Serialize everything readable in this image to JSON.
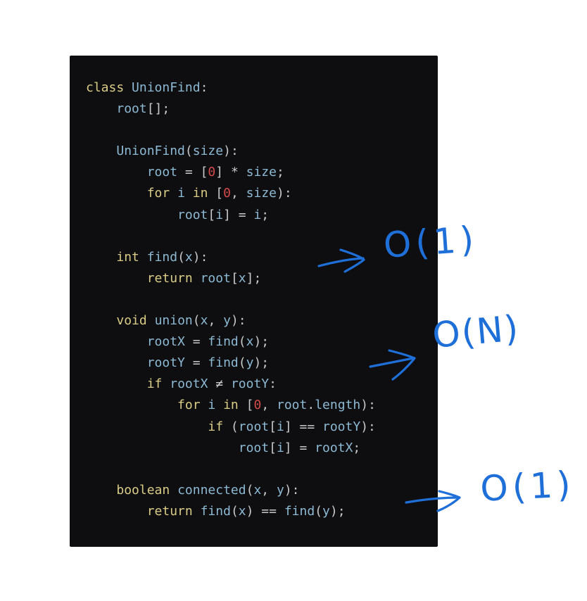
{
  "code": {
    "lines": [
      [
        {
          "t": "class",
          "k": "kw"
        },
        {
          "t": " ",
          "k": "pn"
        },
        {
          "t": "UnionFind",
          "k": "fn"
        },
        {
          "t": ":",
          "k": "pn"
        }
      ],
      [
        {
          "t": "    ",
          "k": "pn"
        },
        {
          "t": "root",
          "k": "var"
        },
        {
          "t": "[];",
          "k": "pn"
        }
      ],
      [],
      [
        {
          "t": "    ",
          "k": "pn"
        },
        {
          "t": "UnionFind",
          "k": "fn"
        },
        {
          "t": "(",
          "k": "pn"
        },
        {
          "t": "size",
          "k": "var"
        },
        {
          "t": "):",
          "k": "pn"
        }
      ],
      [
        {
          "t": "        ",
          "k": "pn"
        },
        {
          "t": "root",
          "k": "var"
        },
        {
          "t": " = [",
          "k": "pn"
        },
        {
          "t": "0",
          "k": "num"
        },
        {
          "t": "] * ",
          "k": "pn"
        },
        {
          "t": "size",
          "k": "var"
        },
        {
          "t": ";",
          "k": "pn"
        }
      ],
      [
        {
          "t": "        ",
          "k": "pn"
        },
        {
          "t": "for",
          "k": "kw"
        },
        {
          "t": " ",
          "k": "pn"
        },
        {
          "t": "i",
          "k": "var"
        },
        {
          "t": " ",
          "k": "pn"
        },
        {
          "t": "in",
          "k": "kw"
        },
        {
          "t": " [",
          "k": "pn"
        },
        {
          "t": "0",
          "k": "num"
        },
        {
          "t": ", ",
          "k": "pn"
        },
        {
          "t": "size",
          "k": "var"
        },
        {
          "t": "):",
          "k": "pn"
        }
      ],
      [
        {
          "t": "            ",
          "k": "pn"
        },
        {
          "t": "root",
          "k": "var"
        },
        {
          "t": "[",
          "k": "pn"
        },
        {
          "t": "i",
          "k": "var"
        },
        {
          "t": "] = ",
          "k": "pn"
        },
        {
          "t": "i",
          "k": "var"
        },
        {
          "t": ";",
          "k": "pn"
        }
      ],
      [],
      [
        {
          "t": "    ",
          "k": "pn"
        },
        {
          "t": "int",
          "k": "kw"
        },
        {
          "t": " ",
          "k": "pn"
        },
        {
          "t": "find",
          "k": "fn"
        },
        {
          "t": "(",
          "k": "pn"
        },
        {
          "t": "x",
          "k": "var"
        },
        {
          "t": "):",
          "k": "pn"
        }
      ],
      [
        {
          "t": "        ",
          "k": "pn"
        },
        {
          "t": "return",
          "k": "kw"
        },
        {
          "t": " ",
          "k": "pn"
        },
        {
          "t": "root",
          "k": "var"
        },
        {
          "t": "[",
          "k": "pn"
        },
        {
          "t": "x",
          "k": "var"
        },
        {
          "t": "];",
          "k": "pn"
        }
      ],
      [],
      [
        {
          "t": "    ",
          "k": "pn"
        },
        {
          "t": "void",
          "k": "kw"
        },
        {
          "t": " ",
          "k": "pn"
        },
        {
          "t": "union",
          "k": "fn"
        },
        {
          "t": "(",
          "k": "pn"
        },
        {
          "t": "x",
          "k": "var"
        },
        {
          "t": ", ",
          "k": "pn"
        },
        {
          "t": "y",
          "k": "var"
        },
        {
          "t": "):",
          "k": "pn"
        }
      ],
      [
        {
          "t": "        ",
          "k": "pn"
        },
        {
          "t": "rootX",
          "k": "var"
        },
        {
          "t": " = ",
          "k": "pn"
        },
        {
          "t": "find",
          "k": "fn"
        },
        {
          "t": "(",
          "k": "pn"
        },
        {
          "t": "x",
          "k": "var"
        },
        {
          "t": ");",
          "k": "pn"
        }
      ],
      [
        {
          "t": "        ",
          "k": "pn"
        },
        {
          "t": "rootY",
          "k": "var"
        },
        {
          "t": " = ",
          "k": "pn"
        },
        {
          "t": "find",
          "k": "fn"
        },
        {
          "t": "(",
          "k": "pn"
        },
        {
          "t": "y",
          "k": "var"
        },
        {
          "t": ");",
          "k": "pn"
        }
      ],
      [
        {
          "t": "        ",
          "k": "pn"
        },
        {
          "t": "if",
          "k": "kw"
        },
        {
          "t": " ",
          "k": "pn"
        },
        {
          "t": "rootX",
          "k": "var"
        },
        {
          "t": " ≠ ",
          "k": "pn"
        },
        {
          "t": "rootY",
          "k": "var"
        },
        {
          "t": ":",
          "k": "pn"
        }
      ],
      [
        {
          "t": "            ",
          "k": "pn"
        },
        {
          "t": "for",
          "k": "kw"
        },
        {
          "t": " ",
          "k": "pn"
        },
        {
          "t": "i",
          "k": "var"
        },
        {
          "t": " ",
          "k": "pn"
        },
        {
          "t": "in",
          "k": "kw"
        },
        {
          "t": " [",
          "k": "pn"
        },
        {
          "t": "0",
          "k": "num"
        },
        {
          "t": ", ",
          "k": "pn"
        },
        {
          "t": "root",
          "k": "var"
        },
        {
          "t": ".",
          "k": "pn"
        },
        {
          "t": "length",
          "k": "var"
        },
        {
          "t": "):",
          "k": "pn"
        }
      ],
      [
        {
          "t": "                ",
          "k": "pn"
        },
        {
          "t": "if",
          "k": "kw"
        },
        {
          "t": " (",
          "k": "pn"
        },
        {
          "t": "root",
          "k": "var"
        },
        {
          "t": "[",
          "k": "pn"
        },
        {
          "t": "i",
          "k": "var"
        },
        {
          "t": "] == ",
          "k": "pn"
        },
        {
          "t": "rootY",
          "k": "var"
        },
        {
          "t": "):",
          "k": "pn"
        }
      ],
      [
        {
          "t": "                    ",
          "k": "pn"
        },
        {
          "t": "root",
          "k": "var"
        },
        {
          "t": "[",
          "k": "pn"
        },
        {
          "t": "i",
          "k": "var"
        },
        {
          "t": "] = ",
          "k": "pn"
        },
        {
          "t": "rootX",
          "k": "var"
        },
        {
          "t": ";",
          "k": "pn"
        }
      ],
      [],
      [
        {
          "t": "    ",
          "k": "pn"
        },
        {
          "t": "boolean",
          "k": "kw"
        },
        {
          "t": " ",
          "k": "pn"
        },
        {
          "t": "connected",
          "k": "fn"
        },
        {
          "t": "(",
          "k": "pn"
        },
        {
          "t": "x",
          "k": "var"
        },
        {
          "t": ", ",
          "k": "pn"
        },
        {
          "t": "y",
          "k": "var"
        },
        {
          "t": "):",
          "k": "pn"
        }
      ],
      [
        {
          "t": "        ",
          "k": "pn"
        },
        {
          "t": "return",
          "k": "kw"
        },
        {
          "t": " ",
          "k": "pn"
        },
        {
          "t": "find",
          "k": "fn"
        },
        {
          "t": "(",
          "k": "pn"
        },
        {
          "t": "x",
          "k": "var"
        },
        {
          "t": ") == ",
          "k": "pn"
        },
        {
          "t": "find",
          "k": "fn"
        },
        {
          "t": "(",
          "k": "pn"
        },
        {
          "t": "y",
          "k": "var"
        },
        {
          "t": ");",
          "k": "pn"
        }
      ]
    ]
  },
  "annotations": {
    "find_complexity": "O(1)",
    "union_complexity": "O(N)",
    "connected_complexity": "O(1)"
  },
  "colors": {
    "panel_background": "#0e0e10",
    "keyword": "#d9cc86",
    "identifier": "#8db9d3",
    "number": "#d24a4a",
    "punctuation": "#c9c9c9",
    "annotation_ink": "#1f6fd8"
  }
}
